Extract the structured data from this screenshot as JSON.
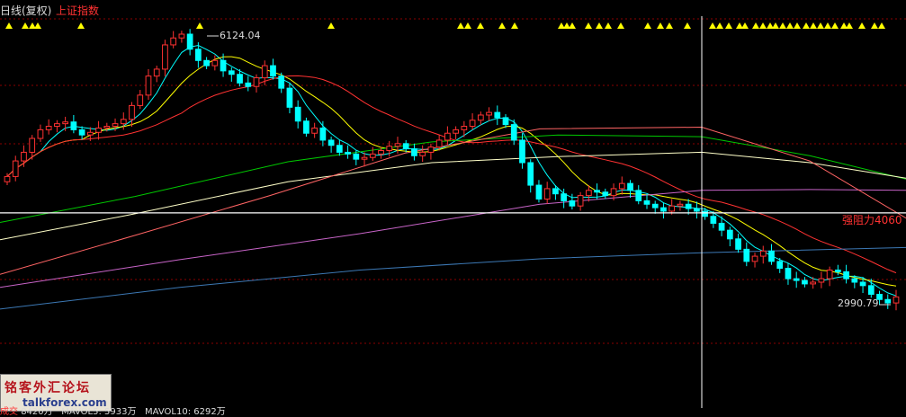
{
  "header": {
    "period_label": "日线(复权)",
    "index_label": "上证指数"
  },
  "chart_data": {
    "type": "candlestick",
    "title": "上证指数",
    "subtitle": "日线(复权)",
    "ylim": [
      2700,
      6300
    ],
    "annotations": {
      "high": "6124.04",
      "low": "2990.79",
      "resistance": "强阻力4060"
    },
    "resistance_level": 4060,
    "crosshair_level": 4060,
    "colors": {
      "up": "#ff3232",
      "down": "#00ffff",
      "grid": "#8b0000",
      "signal": "#ffff00",
      "crosshair": "#ffffff",
      "ma5": "#00ffff",
      "ma10": "#ffff00",
      "ma20": "#ff3232",
      "ma60": "#00c800",
      "ma120": "#ffffc8",
      "ma250": "#c864c8",
      "ma500": "#ff6464",
      "ma1000": "#3c78b4"
    },
    "signal_markers": "yellow triangles along the top",
    "closes": [
      4480,
      4660,
      4760,
      4920,
      5020,
      5060,
      5090,
      5110,
      5020,
      4960,
      4990,
      5040,
      5060,
      5090,
      5140,
      5300,
      5420,
      5640,
      5720,
      6000,
      6080,
      6124,
      5950,
      5820,
      5760,
      5820,
      5700,
      5660,
      5560,
      5520,
      5620,
      5760,
      5640,
      5500,
      5280,
      5120,
      4980,
      5040,
      4900,
      4840,
      4760,
      4740,
      4680,
      4700,
      4740,
      4780,
      4830,
      4860,
      4800,
      4720,
      4760,
      4820,
      4900,
      4980,
      5020,
      5060,
      5130,
      5190,
      5220,
      5160,
      5080,
      4900,
      4640,
      4380,
      4220,
      4340,
      4280,
      4200,
      4140,
      4260,
      4320,
      4300,
      4260,
      4340,
      4400,
      4320,
      4200,
      4160,
      4120,
      4080,
      4140,
      4160,
      4110,
      4080,
      4020,
      3940,
      3860,
      3760,
      3640,
      3500,
      3560,
      3620,
      3500,
      3420,
      3300,
      3280,
      3240,
      3260,
      3300,
      3400,
      3380,
      3300,
      3260,
      3220,
      3120,
      3060,
      3020,
      3090
    ],
    "ma_curves": {
      "ma60": [
        [
          0,
          3950
        ],
        [
          150,
          4250
        ],
        [
          320,
          4650
        ],
        [
          480,
          4880
        ],
        [
          620,
          4960
        ],
        [
          780,
          4940
        ],
        [
          900,
          4720
        ],
        [
          1007,
          4450
        ]
      ],
      "ma120": [
        [
          0,
          3750
        ],
        [
          150,
          4050
        ],
        [
          320,
          4420
        ],
        [
          480,
          4640
        ],
        [
          620,
          4710
        ],
        [
          780,
          4760
        ],
        [
          900,
          4640
        ],
        [
          1007,
          4460
        ]
      ],
      "ma250": [
        [
          0,
          3200
        ],
        [
          200,
          3520
        ],
        [
          400,
          3820
        ],
        [
          600,
          4160
        ],
        [
          780,
          4320
        ],
        [
          900,
          4330
        ],
        [
          1007,
          4320
        ]
      ],
      "ma500": [
        [
          0,
          3350
        ],
        [
          150,
          3800
        ],
        [
          300,
          4260
        ],
        [
          450,
          4750
        ],
        [
          600,
          5030
        ],
        [
          780,
          5050
        ],
        [
          900,
          4660
        ],
        [
          1007,
          4000
        ]
      ],
      "ma1000": [
        [
          0,
          2950
        ],
        [
          200,
          3200
        ],
        [
          400,
          3400
        ],
        [
          600,
          3530
        ],
        [
          780,
          3600
        ],
        [
          1007,
          3660
        ]
      ]
    }
  },
  "watermark": {
    "chinese": "铭客外汇论坛",
    "english": "talkforex.com"
  },
  "footer": {
    "vol_label": "成交",
    "volume": "8420万",
    "mavol5": "MAVOL5: 5933万",
    "mavol10": "MAVOL10: 6292万"
  }
}
